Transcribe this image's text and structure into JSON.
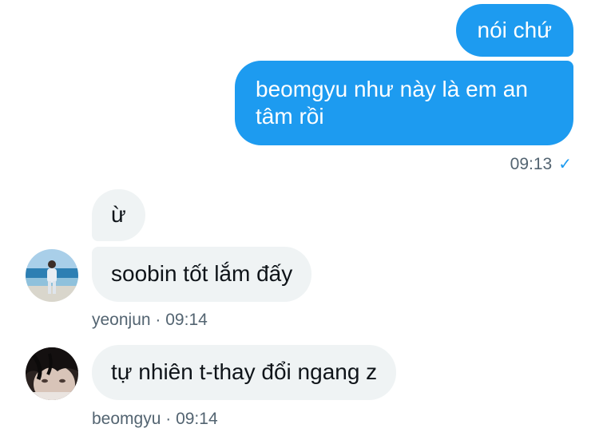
{
  "outgoing": {
    "messages": [
      {
        "text": "nói chứ"
      },
      {
        "text": "beomgyu như này là em an tâm rồi"
      }
    ],
    "time": "09:13",
    "status_icon": "checkmark-icon",
    "status_glyph": "✓"
  },
  "incoming": [
    {
      "user": "yeonjun",
      "separator": "·",
      "time": "09:14",
      "avatar": "beach-photo-avatar",
      "messages": [
        {
          "text": "ừ"
        },
        {
          "text": "soobin tốt lắm đấy"
        }
      ]
    },
    {
      "user": "beomgyu",
      "separator": "·",
      "time": "09:14",
      "avatar": "dark-hair-photo-avatar",
      "messages": [
        {
          "text": "tự nhiên t-thay đổi ngang z"
        }
      ]
    }
  ],
  "colors": {
    "outgoing_bubble": "#1d9bf0",
    "incoming_bubble": "#eff3f4",
    "meta_text": "#536471"
  }
}
